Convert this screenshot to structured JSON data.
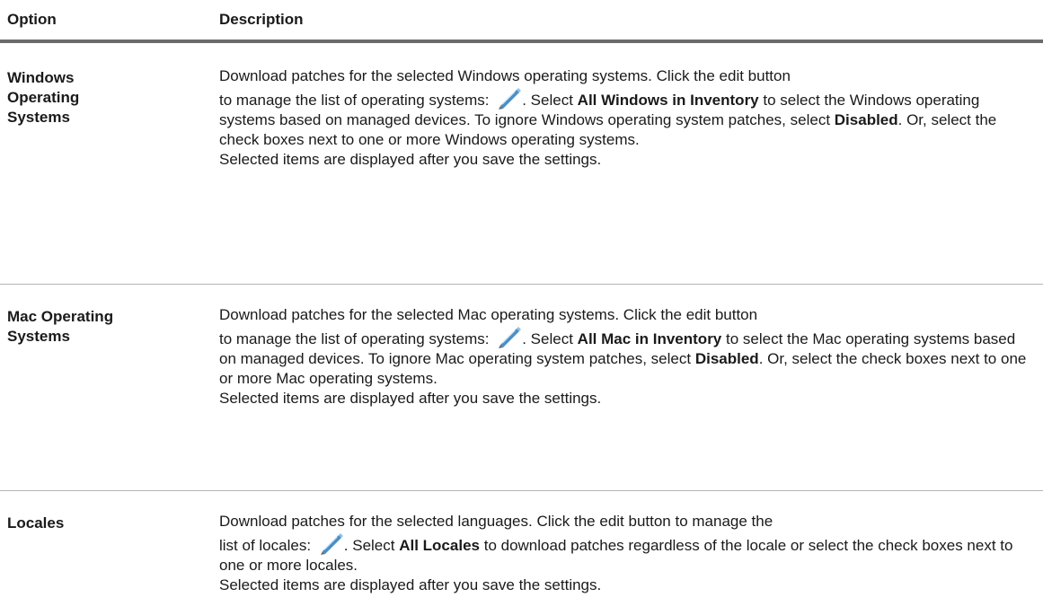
{
  "table": {
    "headers": {
      "option": "Option",
      "description": "Description"
    },
    "rows": [
      {
        "option": "Windows Operating Systems",
        "intro": "Download patches for the selected Windows operating systems. Click the edit button",
        "lead": "to manage the list of operating systems:",
        "after_icon_1": ". Select",
        "bold_1": "All Windows in Inventory",
        "mid_1": "to select the Windows operating systems based on managed devices. To ignore Windows operating system patches, select",
        "bold_2": "Disabled",
        "tail": ". Or, select the check boxes next to one or more Windows operating systems.",
        "note": "Selected items are displayed after you save the settings."
      },
      {
        "option": "Mac Operating Systems",
        "intro": "Download patches for the selected Mac operating systems. Click the edit button",
        "lead": "to manage the list of operating systems:",
        "after_icon_1": ". Select",
        "bold_1": "All Mac in Inventory",
        "mid_1": "to select the Mac operating systems based on managed devices. To ignore Mac operating system patches, select",
        "bold_2": "Disabled",
        "tail": ". Or, select the check boxes next to one or more Mac operating systems.",
        "note": "Selected items are displayed after you save the settings."
      },
      {
        "option": "Locales",
        "intro": "Download patches for the selected languages. Click the edit button to manage the",
        "lead": "list of locales:",
        "after_icon_1": ". Select",
        "bold_1": "All Locales",
        "mid_1": "to download patches regardless of the locale or select the check boxes next to one or more locales.",
        "note": "Selected items are displayed after you save the settings."
      }
    ]
  },
  "icons": {
    "edit": "pencil-icon"
  },
  "colors": {
    "header_rule": "#6b6b6b",
    "row_rule": "#b5b5b5",
    "pencil_blue": "#4a90c8"
  }
}
